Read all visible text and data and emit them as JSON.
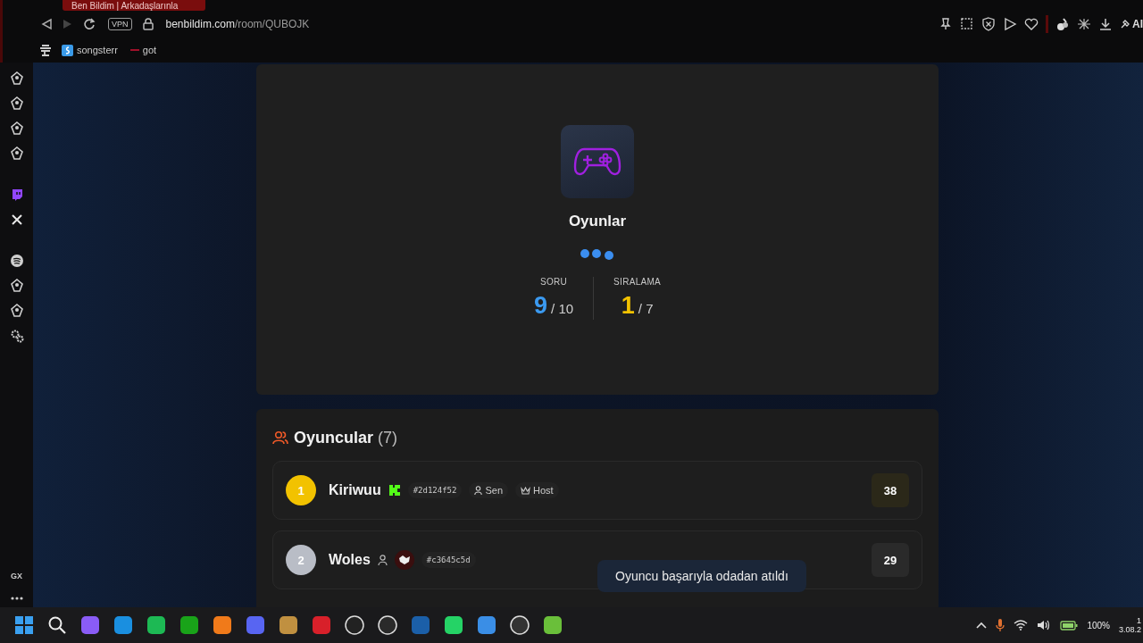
{
  "browser": {
    "tab": {
      "title": "Ben Bildim | Arkadaşlarınla"
    },
    "address": {
      "vpn": "VPN",
      "domain": "benbildim.com",
      "path": "/room/QUBOJK"
    },
    "toolbar_label": "AI",
    "bookmarks": [
      {
        "label": "songsterr",
        "kind": "songsterr"
      },
      {
        "label": "got",
        "kind": "line"
      }
    ]
  },
  "sidebar": {
    "label": "GX"
  },
  "game": {
    "category": "Oyunlar",
    "stats": [
      {
        "label": "SORU",
        "value": "9",
        "total": "/ 10",
        "kind": "question"
      },
      {
        "label": "SIRALAMA",
        "value": "1",
        "total": "/ 7",
        "kind": "rank"
      }
    ]
  },
  "players": {
    "title": "Oyuncular",
    "count": "(7)",
    "items": [
      {
        "rank": "1",
        "color": "#f2c200",
        "name": "Kiriwuu",
        "badges": [
          {
            "kind": "kick"
          }
        ],
        "id": "#2d124f52",
        "tags": [
          {
            "kind": "you",
            "label": "Sen"
          },
          {
            "kind": "host",
            "label": "Host"
          }
        ],
        "score": "38"
      },
      {
        "rank": "2",
        "color": "#b9bdc6",
        "name": "Woles",
        "badges": [
          {
            "kind": "person"
          },
          {
            "kind": "avatar"
          }
        ],
        "id": "#c3645c5d",
        "score": "29"
      }
    ]
  },
  "toast": {
    "message": "Oyuncu başarıyla odadan atıldı"
  },
  "taskbar": {
    "battery": "100%",
    "time": "1",
    "date": "3.08.2"
  }
}
